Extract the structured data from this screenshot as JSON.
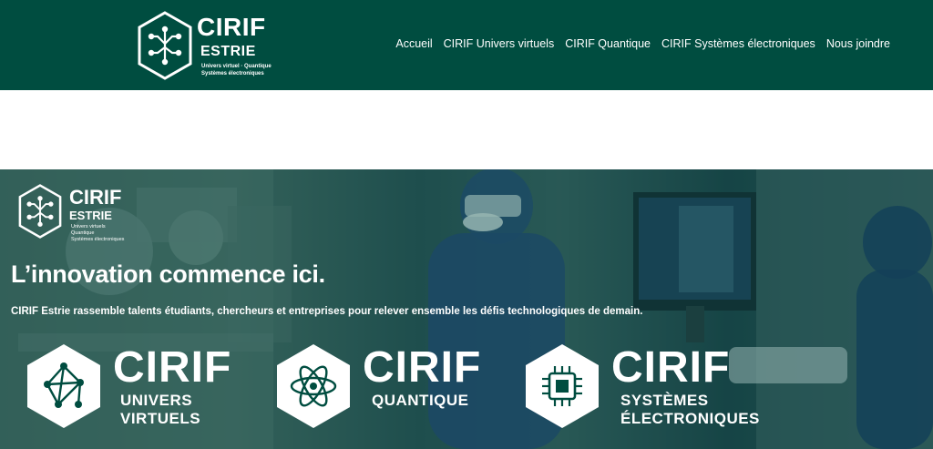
{
  "header": {
    "logo": {
      "title": "CIRIF",
      "subtitle": "ESTRIE",
      "tagline1": "Univers virtuel · Quantique",
      "tagline2": "Systèmes électroniques"
    },
    "nav": [
      {
        "label": "Accueil"
      },
      {
        "label": "CIRIF Univers virtuels"
      },
      {
        "label": "CIRIF Quantique"
      },
      {
        "label": "CIRIF Systèmes électroniques"
      },
      {
        "label": "Nous joindre"
      }
    ]
  },
  "hero": {
    "logo": {
      "title": "CIRIF",
      "subtitle": "ESTRIE",
      "line1": "Univers virtuels",
      "line2": "Quantique",
      "line3": "Systèmes électroniques"
    },
    "title": "L’innovation commence ici.",
    "subtitle": "CIRIF Estrie rassemble talents étudiants, chercheurs et entreprises pour relever ensemble les défis technologiques de demain.",
    "brands": [
      {
        "title": "CIRIF",
        "line1": "UNIVERS",
        "line2": "VIRTUELS",
        "icon": "network-icon"
      },
      {
        "title": "CIRIF",
        "line1": "QUANTIQUE",
        "line2": "",
        "icon": "atom-icon"
      },
      {
        "title": "CIRIF",
        "line1": "SYSTÈMES",
        "line2": "ÉLECTRONIQUES",
        "icon": "chip-icon"
      }
    ]
  },
  "colors": {
    "brand_green": "#004d40",
    "white": "#ffffff"
  }
}
